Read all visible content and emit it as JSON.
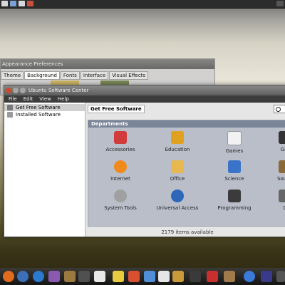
{
  "background_window": {
    "title": "Appearance Preferences",
    "tabs": [
      "Theme",
      "Background",
      "Fonts",
      "Interface",
      "Visual Effects"
    ]
  },
  "software_center": {
    "title": "Ubuntu Software Center",
    "menu": [
      "File",
      "Edit",
      "View",
      "Help"
    ],
    "sidebar": [
      "Get Free Software",
      "Installed Software"
    ],
    "breadcrumb": "Get Free Software",
    "departments_heading": "Departments",
    "departments": [
      {
        "label": "Accessories",
        "icon": "accessories-icon",
        "color": "#d23b3b"
      },
      {
        "label": "Education",
        "icon": "education-icon",
        "color": "#e0a020"
      },
      {
        "label": "Games",
        "icon": "games-icon",
        "color": "#f2f2f2"
      },
      {
        "label": "Gra",
        "icon": "graphics-icon",
        "color": "#333333"
      },
      {
        "label": "Internet",
        "icon": "internet-icon",
        "color": "#f08a1a"
      },
      {
        "label": "Office",
        "icon": "office-icon",
        "color": "#e8b850"
      },
      {
        "label": "Science",
        "icon": "science-icon",
        "color": "#3a74c8"
      },
      {
        "label": "Sound",
        "icon": "sound-icon",
        "color": "#8b6a3a"
      },
      {
        "label": "System Tools",
        "icon": "system-tools-icon",
        "color": "#a0a0a0"
      },
      {
        "label": "Universal Access",
        "icon": "universal-access-icon",
        "color": "#2d68b8"
      },
      {
        "label": "Programming",
        "icon": "programming-icon",
        "color": "#3b3b3b"
      },
      {
        "label": "O",
        "icon": "other-icon",
        "color": "#666666"
      }
    ],
    "status": "2179 items available"
  },
  "taskbar_icons": [
    {
      "name": "firefox-icon",
      "color": "#e06b1c"
    },
    {
      "name": "thunderbird-icon",
      "color": "#3b6fb8"
    },
    {
      "name": "network-icon",
      "color": "#2a7ad0"
    },
    {
      "name": "pidgin-icon",
      "color": "#8a5ab0"
    },
    {
      "name": "camera-icon",
      "color": "#9a7a40"
    },
    {
      "name": "terminal-icon",
      "color": "#505050"
    },
    {
      "name": "ipod-icon",
      "color": "#e8e8e8"
    },
    {
      "name": "notes-icon",
      "color": "#e8cc40"
    },
    {
      "name": "photos-icon",
      "color": "#d85030"
    },
    {
      "name": "office-icon",
      "color": "#4f8fd8"
    },
    {
      "name": "writer-icon",
      "color": "#e6e6e6"
    },
    {
      "name": "folder-icon",
      "color": "#c89a3a"
    },
    {
      "name": "music-icon",
      "color": "#3a3a3a"
    },
    {
      "name": "tools-icon",
      "color": "#c83030"
    },
    {
      "name": "chat-icon",
      "color": "#a07a4a"
    },
    {
      "name": "globe-icon",
      "color": "#3a7ad8"
    },
    {
      "name": "night-icon",
      "color": "#3a3a8a"
    },
    {
      "name": "power-icon",
      "color": "#555555"
    }
  ]
}
